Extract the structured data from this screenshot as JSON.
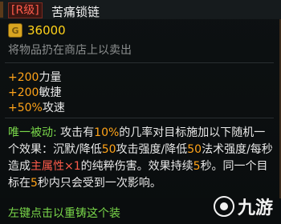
{
  "header": {
    "rank_badge": "[R级]",
    "item_name": "苦痛锁链"
  },
  "price": {
    "icon": "gold-coin-icon",
    "value": "36000"
  },
  "sell_hint": "将物品扔在商店上以卖出",
  "stats": [
    {
      "value": "+200",
      "label": "力量"
    },
    {
      "value": "+200",
      "label": "敏捷"
    },
    {
      "value": "+50%",
      "label": "攻速"
    }
  ],
  "passive": {
    "title": "唯一被动:",
    "t1": "攻击有",
    "n1": "10%",
    "t2": "的几率对目标施加以下随机一个效果：沉默/降低",
    "n2": "50",
    "t3": "攻击强度/降低",
    "n3": "50",
    "t4": "法术强度/每秒造成",
    "n4": "主属性×1",
    "t5": "的纯粹伤害。效果持续",
    "n5": "5",
    "t6": "秒。同一个目标在",
    "n6": "5",
    "t7": "秒内只会受到一次影响。"
  },
  "footer_text": "左键点击以重铸这个装",
  "watermark": {
    "text": "九游",
    "icon": "jiuyou-logo-icon"
  },
  "colors": {
    "rank": "#ff5b4b",
    "price": "#ffd21a",
    "stat_value": "#ffa319",
    "passive_title": "#7ad84a",
    "passive_highlight": "#ffa319",
    "primary_attr": "#ff5b4b"
  }
}
